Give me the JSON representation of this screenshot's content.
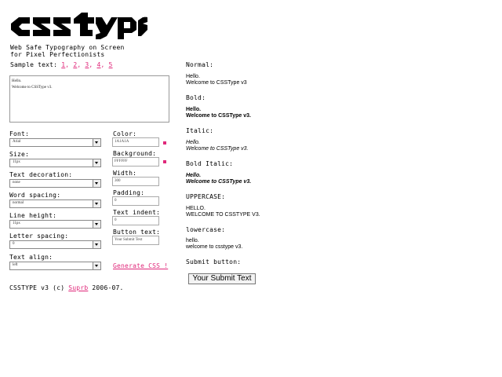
{
  "logo": "csstype",
  "tagline": [
    "Web Safe Typography on Screen",
    "for Pixel Perfectionists"
  ],
  "sample": {
    "label": "Sample text:",
    "links": [
      "1",
      "2",
      "3",
      "4",
      "5"
    ],
    "textarea": [
      "Hello.",
      "Welcome to CSSType v3."
    ]
  },
  "left_fields": [
    {
      "label": "Font:",
      "value": "Arial"
    },
    {
      "label": "Size:",
      "value": "11px"
    },
    {
      "label": "Text decoration:",
      "value": "none"
    },
    {
      "label": "Word spacing:",
      "value": "normal"
    },
    {
      "label": "Line height:",
      "value": "11px"
    },
    {
      "label": "Letter spacing:",
      "value": "0"
    },
    {
      "label": "Text align:",
      "value": "left"
    }
  ],
  "right_fields": [
    {
      "label": "Color:",
      "value": "1A1A1A"
    },
    {
      "label": "Background:",
      "value": "FFFFFF"
    },
    {
      "label": "Width:",
      "value": "300"
    },
    {
      "label": "Padding:",
      "value": "0"
    },
    {
      "label": "Text indent:",
      "value": "0"
    },
    {
      "label": "Button text:",
      "value": "Your Submit Text"
    }
  ],
  "generate": "Generate CSS !",
  "footer": {
    "prefix": "CSSTYPE v3 (c)",
    "link": "Suprb",
    "suffix": "2006-07."
  },
  "previews": [
    {
      "title": "Normal:",
      "line1": "Hello.",
      "line2": "Welcome to CSSType v3"
    },
    {
      "title": "Bold:",
      "line1": "Hello.",
      "line2": "Welcome to CSSType v3."
    },
    {
      "title": "Italic:",
      "line1": "Hello.",
      "line2": "Welcome to CSSType v3."
    },
    {
      "title": "Bold Italic:",
      "line1": "Hello.",
      "line2": "Welcome to CSSType v3."
    },
    {
      "title": "UPPERCASE:",
      "line1": "HELLO.",
      "line2": "WELCOME TO CSSTYPE V3."
    },
    {
      "title": "lowercase:",
      "line1": "hello.",
      "line2": "welcome to csstype v3."
    }
  ],
  "submit": {
    "title": "Submit button:",
    "label": "Your Submit Text"
  },
  "colors": {
    "accent": "#e0287a"
  }
}
